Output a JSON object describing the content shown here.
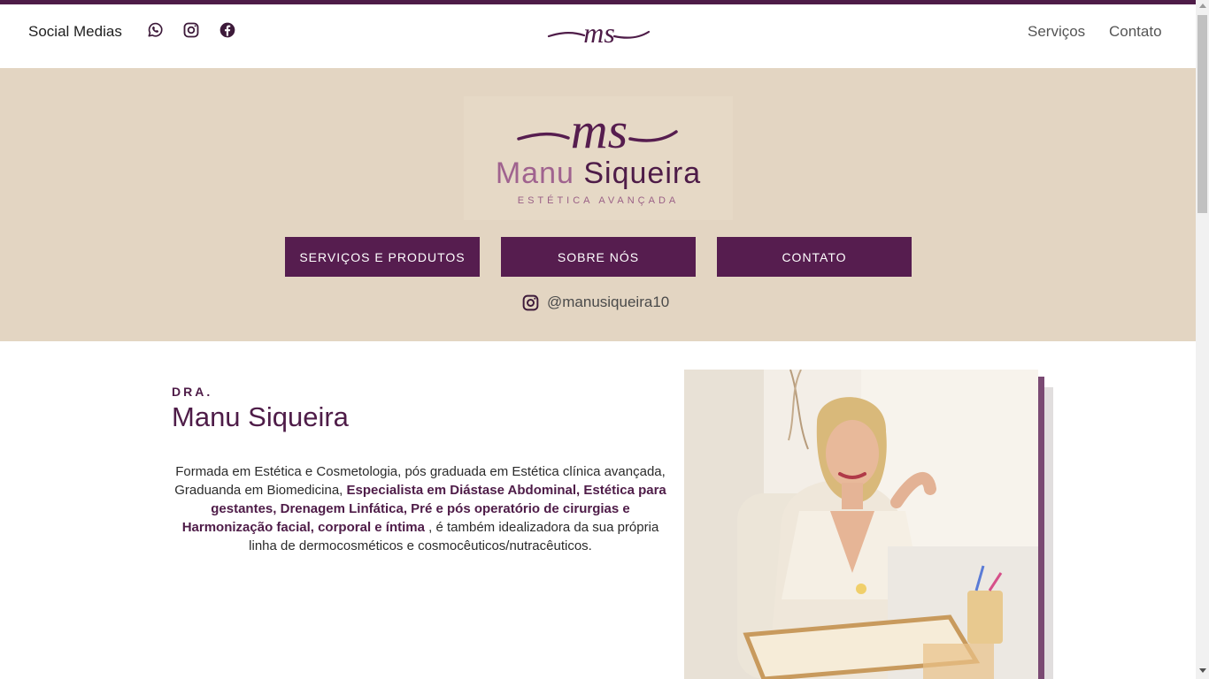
{
  "header": {
    "social_label": "Social Medias",
    "social_icons": [
      "whatsapp-icon",
      "instagram-icon",
      "facebook-icon"
    ],
    "logo_icon": "ms-monogram-logo",
    "nav": [
      {
        "label": "Serviços"
      },
      {
        "label": "Contato"
      }
    ]
  },
  "hero": {
    "brand_first": "Manu",
    "brand_second": "Siqueira",
    "brand_tagline": "ESTÉTICA AVANÇADA",
    "buttons": [
      {
        "label": "SERVIÇOS E PRODUTOS"
      },
      {
        "label": "SOBRE NÓS"
      },
      {
        "label": "CONTATO"
      }
    ],
    "instagram_handle": "@manusiqueira10"
  },
  "about": {
    "prefix": "DRA.",
    "name": "Manu Siqueira",
    "bio_part1": "Formada em Estética e Cosmetologia, pós graduada em Estética clínica avançada, Graduanda em Biomedicina,",
    "bio_bold": "Especialista em Diástase Abdominal, Estética para gestantes, Drenagem Linfática, Pré e pós operatório de cirurgias e Harmonização facial, corporal e íntima",
    "bio_part2": ", é também idealizadora da sua própria linha de dermocosméticos e cosmocêuticos/nutracêuticos."
  },
  "colors": {
    "brand_purple": "#561d4f",
    "hero_beige": "#e3d5c2",
    "accent_mauve": "#a0638f"
  }
}
